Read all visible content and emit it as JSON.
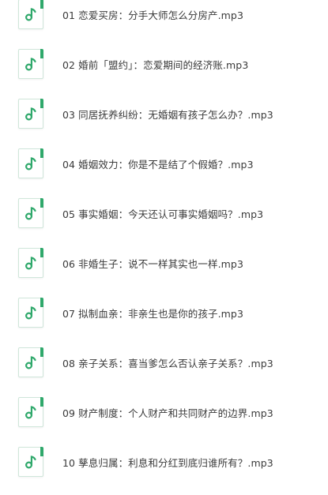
{
  "accent_color": "#2fa86b",
  "icon": "music-note-icon",
  "files": [
    {
      "name": "01 恋爱买房：分手大师怎么分房产.mp3"
    },
    {
      "name": "02 婚前「盟约」：恋爱期间的经济账.mp3"
    },
    {
      "name": "03 同居抚养纠纷：无婚姻有孩子怎么办？.mp3"
    },
    {
      "name": "04 婚姻效力：你是不是结了个假婚？.mp3"
    },
    {
      "name": "05 事实婚姻：今天还认可事实婚姻吗？.mp3"
    },
    {
      "name": "06 非婚生子：说不一样其实也一样.mp3"
    },
    {
      "name": "07 拟制血亲：非亲生也是你的孩子.mp3"
    },
    {
      "name": "08 亲子关系：喜当爹怎么否认亲子关系？.mp3"
    },
    {
      "name": "09 财产制度：个人财产和共同财产的边界.mp3"
    },
    {
      "name": "10 孳息归属：利息和分红到底归谁所有？.mp3"
    }
  ]
}
